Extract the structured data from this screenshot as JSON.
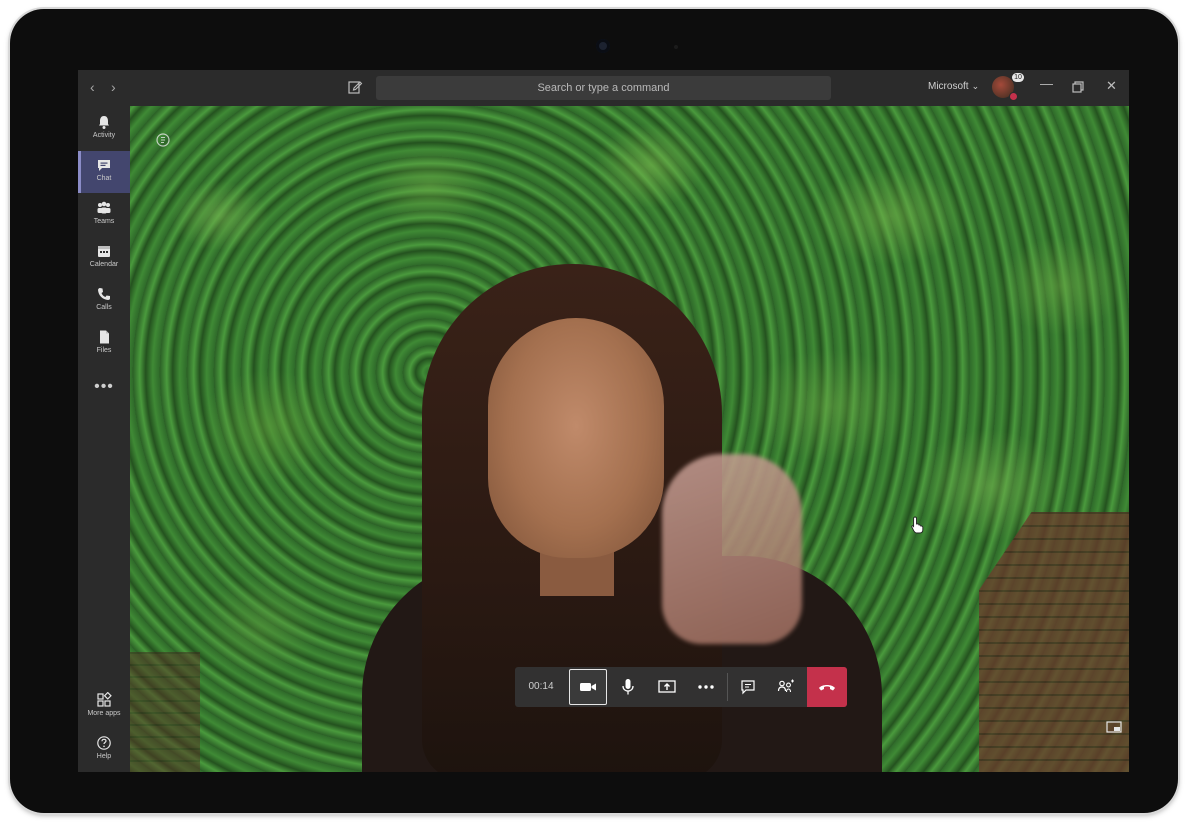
{
  "titlebar": {
    "back_icon": "chevron-left-icon",
    "forward_icon": "chevron-right-icon",
    "compose_icon": "compose-icon",
    "search_placeholder": "Search or type a command",
    "org_name": "Microsoft",
    "avatar_badge": "10",
    "avatar_status_color": "#c4314b",
    "minimize_icon": "minimize-icon",
    "maximize_icon": "maximize-icon",
    "close_icon": "close-icon"
  },
  "rail": {
    "items": [
      {
        "label": "Activity",
        "icon": "bell-icon"
      },
      {
        "label": "Chat",
        "icon": "chat-icon",
        "active": true
      },
      {
        "label": "Teams",
        "icon": "teams-icon"
      },
      {
        "label": "Calendar",
        "icon": "calendar-icon"
      },
      {
        "label": "Calls",
        "icon": "phone-icon"
      },
      {
        "label": "Files",
        "icon": "file-icon"
      }
    ],
    "more_label": "•••",
    "bottom": [
      {
        "label": "More apps",
        "icon": "apps-icon"
      },
      {
        "label": "Help",
        "icon": "help-icon"
      }
    ],
    "accent_color": "#43466e"
  },
  "call": {
    "timer": "00:14",
    "controls": [
      "camera-icon",
      "microphone-icon",
      "share-screen-icon",
      "more-options-icon",
      "chat-icon",
      "participants-icon",
      "hang-up-icon"
    ],
    "hangup_color": "#c4314b"
  }
}
